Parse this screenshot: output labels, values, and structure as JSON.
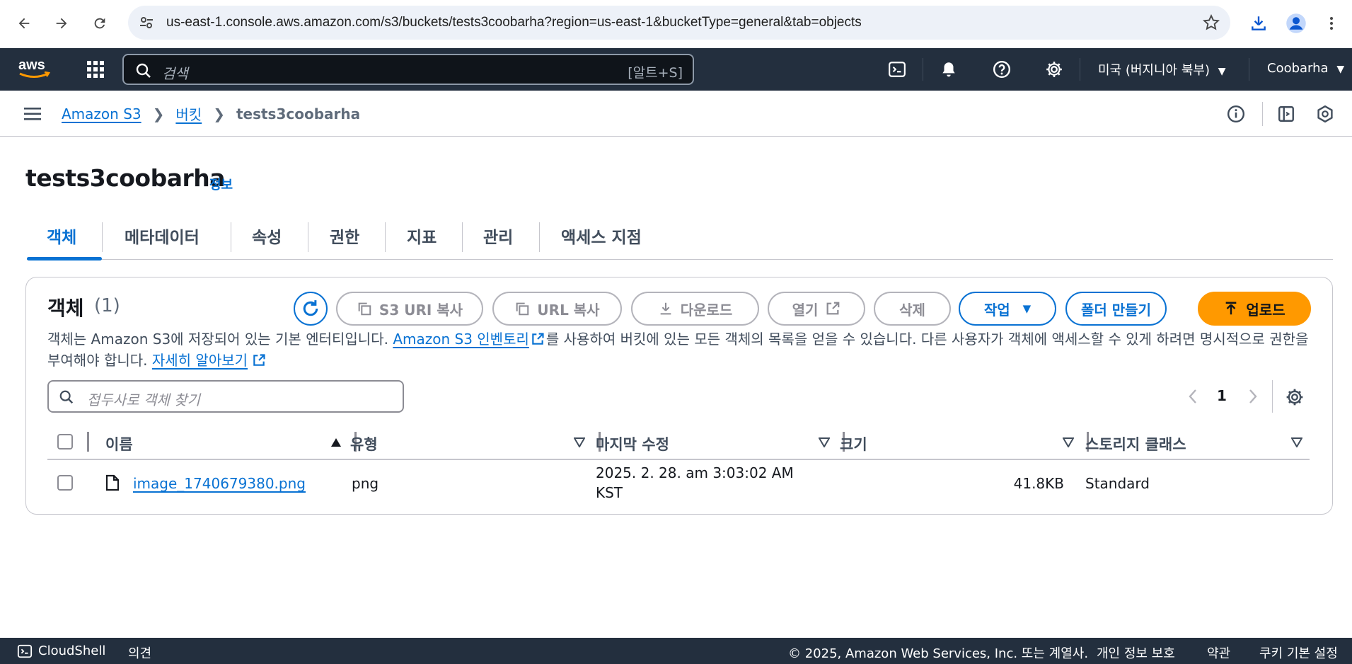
{
  "browser": {
    "url": "us-east-1.console.aws.amazon.com/s3/buckets/tests3coobarha?region=us-east-1&bucketType=general&tab=objects"
  },
  "aws_nav": {
    "logo_text": "aws",
    "search_placeholder": "검색",
    "search_shortcut": "[알트+S]",
    "region": "미국 (버지니아 북부)",
    "account": "Coobarha"
  },
  "breadcrumb": {
    "items": [
      "Amazon S3",
      "버킷"
    ],
    "current": "tests3coobarha"
  },
  "page": {
    "title": "tests3coobarha",
    "info": "정보"
  },
  "tabs": [
    "객체",
    "메타데이터",
    "속성",
    "권한",
    "지표",
    "관리",
    "액세스 지점"
  ],
  "objects_panel": {
    "title": "객체",
    "count": "(1)",
    "buttons": {
      "copy_s3_uri": "S3 URI 복사",
      "copy_url": "URL 복사",
      "download": "다운로드",
      "open": "열기",
      "delete": "삭제",
      "actions": "작업",
      "create_folder": "폴더 만들기",
      "upload": "업로드"
    },
    "description_part1": "객체는 Amazon S3에 저장되어 있는 기본 엔터티입니다. ",
    "description_link1": "Amazon S3 인벤토리",
    "description_part2": "를 사용하여 버킷에 있는 모든 객체의 목록을 얻을 수 있습니다. 다른 사용자가 객체에 액세스할 수 있게 하려면 명시적으로 권한을 부여해야 합니다. ",
    "description_link2": "자세히 알아보기",
    "filter_placeholder": "접두사로 객체 찾기",
    "page_number": "1"
  },
  "table": {
    "columns": [
      "이름",
      "유형",
      "마지막 수정",
      "크기",
      "스토리지 클래스"
    ],
    "rows": [
      {
        "name": "image_1740679380.png",
        "type": "png",
        "modified_line1": "2025. 2. 28. am 3:03:02 AM",
        "modified_line2": "KST",
        "size": "41.8KB",
        "storage_class": "Standard"
      }
    ]
  },
  "footer": {
    "cloudshell": "CloudShell",
    "feedback": "의견",
    "copyright": "© 2025, Amazon Web Services, Inc. 또는 계열사.",
    "privacy": "개인 정보 보호",
    "terms": "약관",
    "cookies": "쿠키 기본 설정"
  },
  "colors": {
    "aws_nav_bg": "#232f3e",
    "link_blue": "#0972d3",
    "primary_orange": "#ff9900"
  }
}
